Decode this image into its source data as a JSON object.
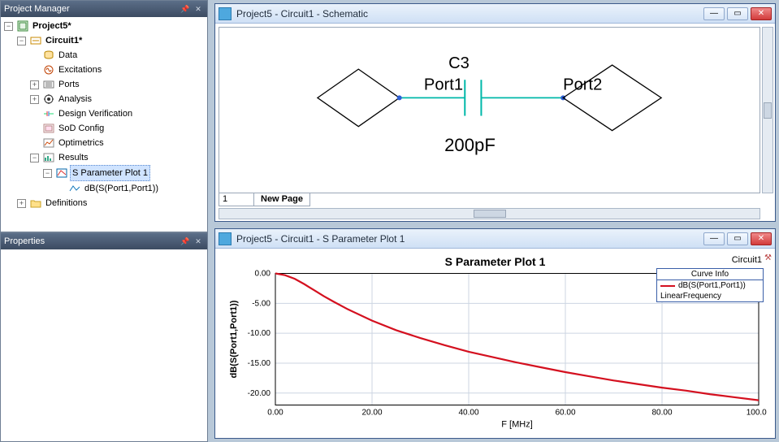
{
  "panels": {
    "project_manager_title": "Project Manager",
    "properties_title": "Properties"
  },
  "tree": {
    "project": "Project5*",
    "circuit": "Circuit1*",
    "data": "Data",
    "excitations": "Excitations",
    "ports": "Ports",
    "analysis": "Analysis",
    "design_verification": "Design Verification",
    "sod_config": "SoD Config",
    "optimetrics": "Optimetrics",
    "results": "Results",
    "s_param_plot": "S Parameter Plot 1",
    "db_s": "dB(S(Port1,Port1))",
    "definitions": "Definitions"
  },
  "schematic": {
    "window_title": "Project5 - Circuit1 - Schematic",
    "c_label": "C3",
    "port1": "Port1",
    "port2": "Port2",
    "cap_value": "200pF",
    "page_num": "1",
    "new_page_tab": "New Page"
  },
  "plot_window": {
    "window_title": "Project5 - Circuit1 - S Parameter Plot 1",
    "title": "S Parameter Plot 1",
    "circuit_label": "Circuit1",
    "legend_header": "Curve Info",
    "legend_item": "dB(S(Port1,Port1))",
    "legend_sub": "LinearFrequency"
  },
  "chart_data": {
    "type": "line",
    "title": "S Parameter Plot 1",
    "xlabel": "F [MHz]",
    "ylabel": "dB(S(Port1,Port1))",
    "xlim": [
      0,
      100
    ],
    "ylim": [
      -22,
      0
    ],
    "xticks": [
      0,
      20,
      40,
      60,
      80,
      100
    ],
    "yticks": [
      0,
      -5,
      -10,
      -15,
      -20
    ],
    "series": [
      {
        "name": "dB(S(Port1,Port1))",
        "color": "#d4101f",
        "x": [
          0,
          2,
          4,
          6,
          8,
          10,
          12,
          15,
          20,
          25,
          30,
          35,
          40,
          45,
          50,
          55,
          60,
          65,
          70,
          75,
          80,
          85,
          90,
          95,
          100
        ],
        "y": [
          0,
          -0.3,
          -0.9,
          -1.8,
          -2.8,
          -3.8,
          -4.7,
          -6.0,
          -7.9,
          -9.5,
          -10.8,
          -12.0,
          -13.1,
          -14.0,
          -14.9,
          -15.7,
          -16.5,
          -17.2,
          -17.9,
          -18.5,
          -19.1,
          -19.6,
          -20.2,
          -20.7,
          -21.2
        ]
      }
    ]
  }
}
